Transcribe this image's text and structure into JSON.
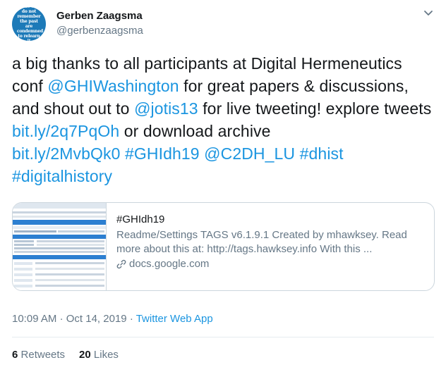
{
  "author": {
    "name": "Gerben Zaagsma",
    "handle": "@gerbenzaagsma",
    "avatar_text": "Some who do not remember the past are condemned to relearn it"
  },
  "tweet": {
    "t1": "a big thanks to all participants at Digital Hermeneutics conf ",
    "l1": "@GHIWashington",
    "t2": " for great papers & discussions, and shout out to ",
    "l2": "@jotis13",
    "t3": " for live tweeting! explore tweets ",
    "l3": "bit.ly/2q7PqOh",
    "t4": " or download archive ",
    "l4": "bit.ly/2MvbQk0",
    "l5": "#GHIdh19",
    "l6": "@C2DH_LU",
    "l7": "#dhist",
    "l8": "#digitalhistory"
  },
  "card": {
    "tag": "#GHIdh19",
    "description": "Readme/Settings TAGS v6.1.9.1 Created by mhawksey. Read more about this at: http://tags.hawksey.info With this ...",
    "domain": "docs.google.com"
  },
  "meta": {
    "time": "10:09 AM",
    "date": "Oct 14, 2019",
    "separator": "·",
    "source": "Twitter Web App"
  },
  "stats": {
    "retweets_count": "6",
    "retweets_label": "Retweets",
    "likes_count": "20",
    "likes_label": "Likes"
  },
  "colors": {
    "link": "#1b95e0",
    "secondary": "#657786",
    "border": "#ccd6dd"
  }
}
